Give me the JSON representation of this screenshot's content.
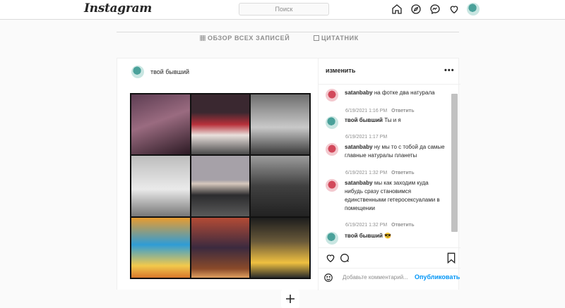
{
  "header": {
    "logo": "Instagram",
    "search_placeholder": "Поиск"
  },
  "nav": {
    "icons": [
      "home-icon",
      "explore-icon",
      "messenger-icon",
      "heart-icon",
      "avatar"
    ]
  },
  "tabs": [
    {
      "icon": "grid-icon",
      "label": "ОБЗОР ВСЕХ ЗАПИСЕЙ"
    },
    {
      "icon": "quote-icon",
      "label": "ЦИТАТНИК"
    }
  ],
  "post": {
    "author": "твой бывший",
    "panel_title": "изменить",
    "comments": [
      {
        "user": "satanbaby",
        "text": "на фотке два натурала",
        "time": "6/19/2021 1:16 PM",
        "reply": "Ответить"
      },
      {
        "user": "твой бывший",
        "text": "Ты и я",
        "time": "6/19/2021 1:17 PM",
        "reply": ""
      },
      {
        "user": "satanbaby",
        "text": "ну мы то с тобой да самые главные натуралы планеты",
        "time": "6/19/2021 1:32 PM",
        "reply": "Ответить"
      },
      {
        "user": "satanbaby",
        "text": "мы как заходим куда нибудь сразу становимся единственными гетеросексуалами в помещении",
        "time": "6/19/2021 1:32 PM",
        "reply": "Ответить"
      },
      {
        "user": "твой бывший",
        "text": "😎",
        "time": "",
        "reply": ""
      }
    ],
    "add_comment_placeholder": "Добавьте комментарий...",
    "publish_label": "Опубликовать"
  },
  "colors": {
    "accent": "#0095f6",
    "border": "#dbdbdb",
    "muted": "#8e8e8e"
  }
}
